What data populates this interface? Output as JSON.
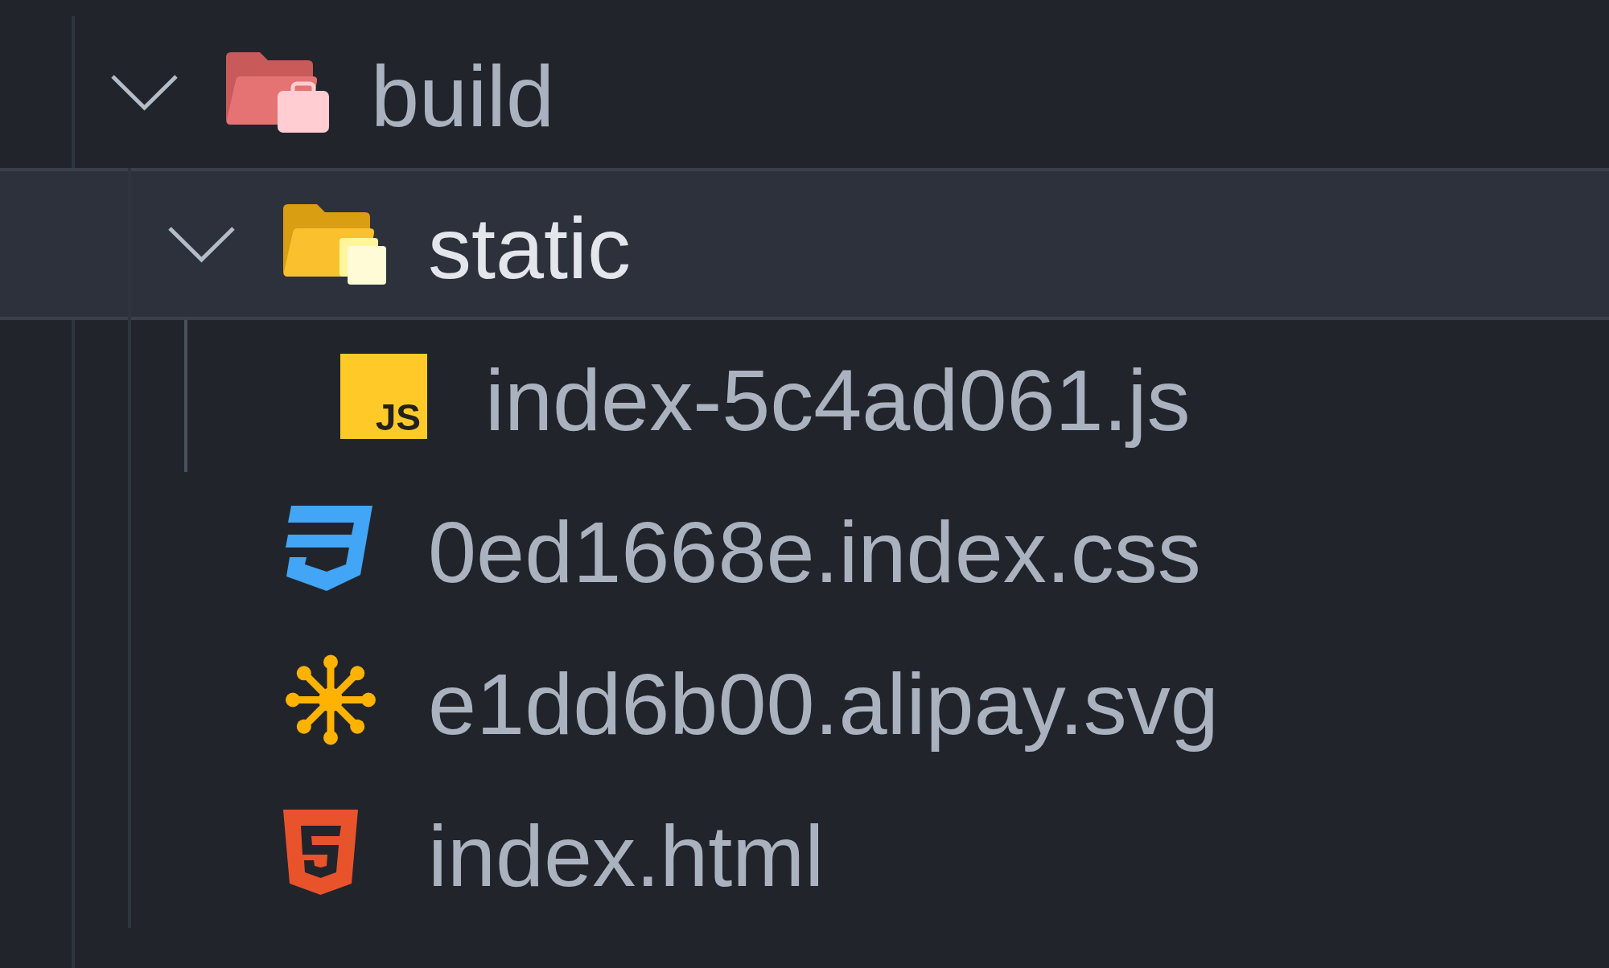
{
  "tree": [
    {
      "label": "build",
      "kind": "distfolder",
      "expanded": true,
      "selected": false,
      "children": [
        {
          "label": "static",
          "kind": "staticfolder",
          "expanded": true,
          "selected": true,
          "children": [
            {
              "label": "index-5c4ad061.js",
              "kind": "script",
              "badge": "JS",
              "selected": false
            }
          ]
        },
        {
          "label": "0ed1668e.index.css",
          "kind": "stylesheet",
          "selected": false
        },
        {
          "label": "e1dd6b00.alipay.svg",
          "kind": "vector",
          "selected": false
        },
        {
          "label": "index.html",
          "kind": "markup",
          "selected": false
        }
      ]
    }
  ]
}
